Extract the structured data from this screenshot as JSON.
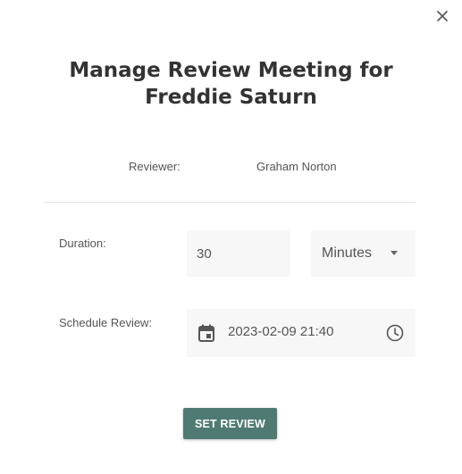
{
  "dialog": {
    "title": "Manage Review Meeting for Freddie Saturn",
    "close_icon": "close-icon"
  },
  "reviewer": {
    "label": "Reviewer:",
    "value": "Graham Norton"
  },
  "duration": {
    "label": "Duration:",
    "value": "30",
    "unit_selected": "Minutes",
    "caret_icon": "caret-down-icon"
  },
  "schedule": {
    "label": "Schedule Review:",
    "value": "2023-02-09 21:40",
    "calendar_icon": "calendar-icon",
    "clock_icon": "clock-icon"
  },
  "actions": {
    "submit_label": "SET REVIEW"
  },
  "colors": {
    "primary_button": "#4f7a73",
    "field_background": "#f7f7f7",
    "text": "#333333"
  }
}
